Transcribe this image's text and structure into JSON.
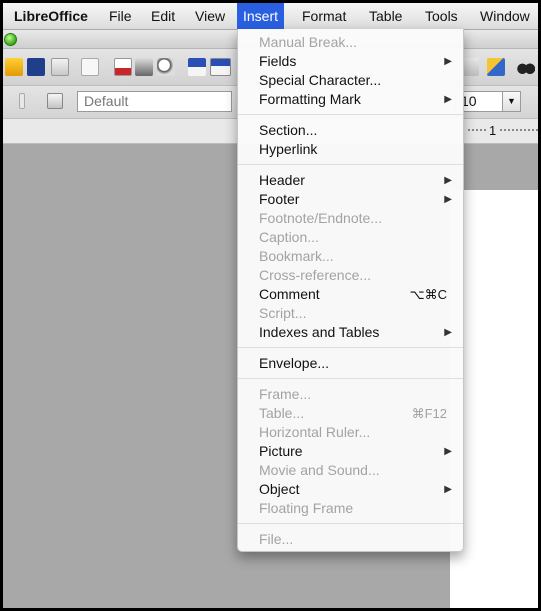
{
  "menubar": {
    "app": "LibreOffice",
    "items": [
      "File",
      "Edit",
      "View",
      "Insert",
      "Format",
      "Table",
      "Tools",
      "Window"
    ]
  },
  "toolbar": {
    "paragraph_style": "Default",
    "font_size": "10"
  },
  "ruler": {
    "number": "1"
  },
  "insert_menu": {
    "manual_break": "Manual Break...",
    "fields": "Fields",
    "special_character": "Special Character...",
    "formatting_mark": "Formatting Mark",
    "section": "Section...",
    "hyperlink": "Hyperlink",
    "header": "Header",
    "footer": "Footer",
    "footnote": "Footnote/Endnote...",
    "caption": "Caption...",
    "bookmark": "Bookmark...",
    "cross_reference": "Cross-reference...",
    "comment": "Comment",
    "comment_shortcut": "⌥⌘C",
    "script": "Script...",
    "indexes_tables": "Indexes and Tables",
    "envelope": "Envelope...",
    "frame": "Frame...",
    "table": "Table...",
    "table_shortcut": "⌘F12",
    "horizontal_ruler": "Horizontal Ruler...",
    "picture": "Picture",
    "movie_sound": "Movie and Sound...",
    "object": "Object",
    "floating_frame": "Floating Frame",
    "file": "File..."
  },
  "colors": {
    "accent": "#2b5fe1",
    "disabled_text": "#a3a3a3"
  }
}
